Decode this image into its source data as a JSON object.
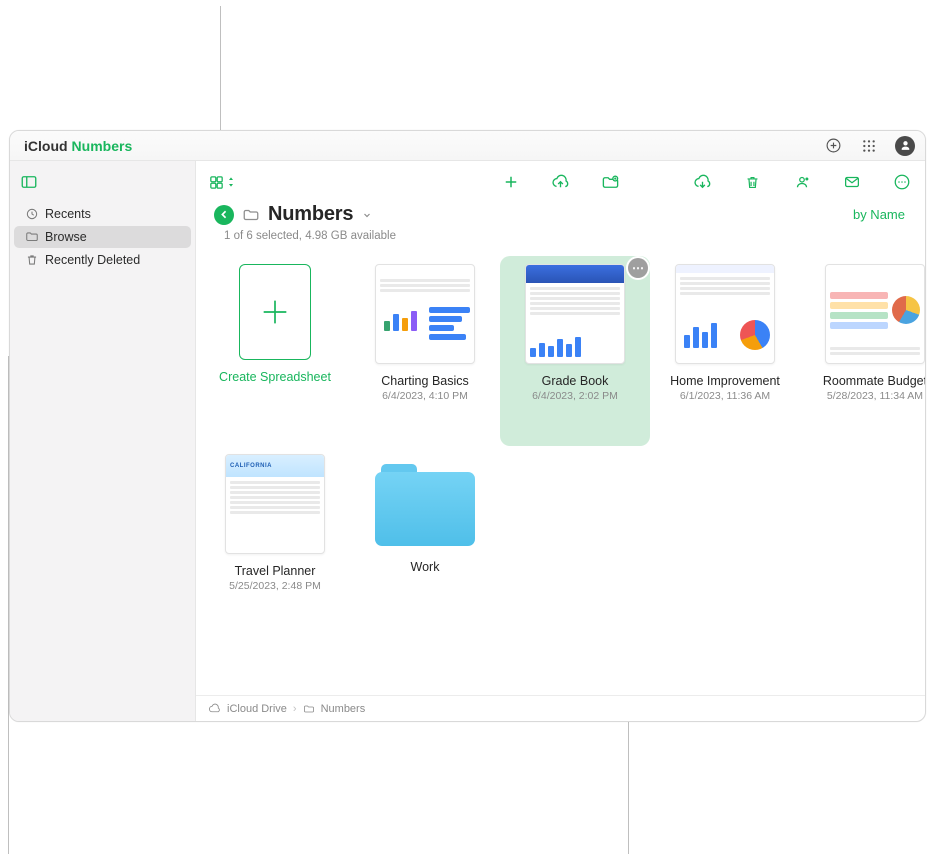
{
  "brand": {
    "icloud": "iCloud",
    "app": "Numbers"
  },
  "sidebar": {
    "items": [
      {
        "label": "Recents"
      },
      {
        "label": "Browse"
      },
      {
        "label": "Recently Deleted"
      }
    ]
  },
  "header": {
    "location": "Numbers",
    "selection_info": "1 of 6 selected, 4.98 GB available",
    "sort_label": "by Name"
  },
  "create": {
    "label": "Create Spreadsheet"
  },
  "files": [
    {
      "name": "Charting Basics",
      "date": "6/4/2023, 4:10 PM"
    },
    {
      "name": "Grade Book",
      "date": "6/4/2023, 2:02 PM",
      "selected": true
    },
    {
      "name": "Home Improvement",
      "date": "6/1/2023, 11:36 AM"
    },
    {
      "name": "Roommate Budget",
      "date": "5/28/2023, 11:34 AM"
    },
    {
      "name": "Travel Planner",
      "date": "5/25/2023, 2:48 PM"
    }
  ],
  "folders": [
    {
      "name": "Work"
    }
  ],
  "breadcrumb": {
    "root": "iCloud Drive",
    "current": "Numbers"
  }
}
